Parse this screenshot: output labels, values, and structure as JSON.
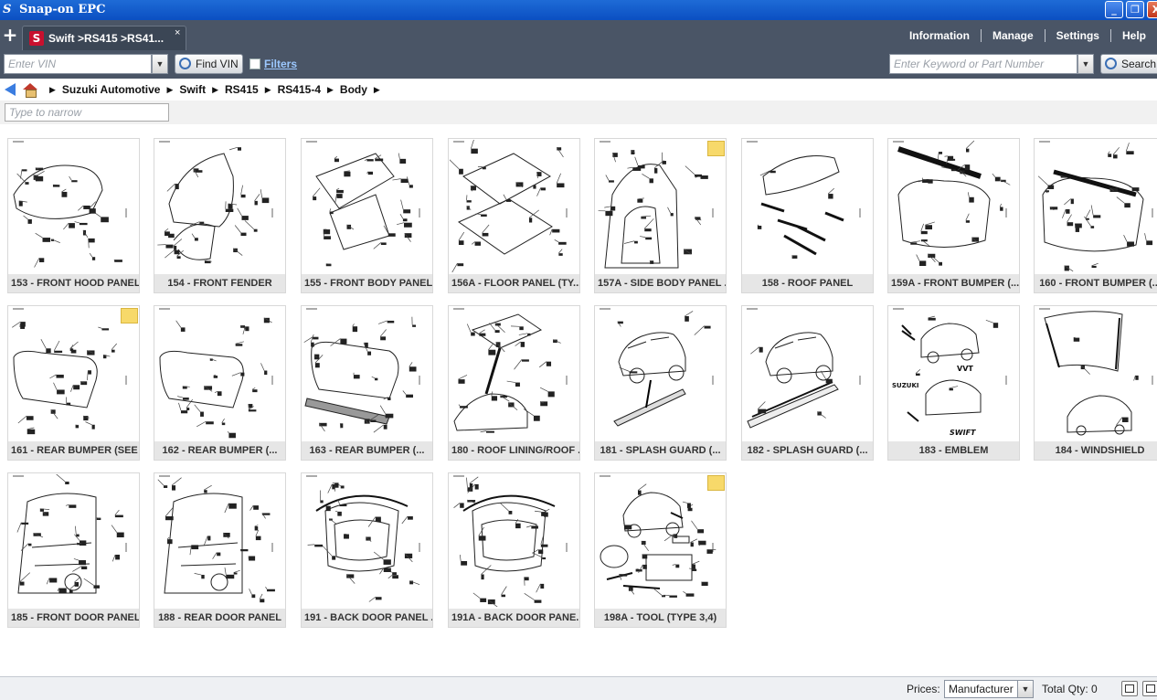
{
  "window": {
    "title": "Snap-on EPC",
    "app_icon": "snap-on-logo",
    "buttons": {
      "minimize": "_",
      "restore": "❐",
      "close": "X"
    }
  },
  "tabs": [
    {
      "label": "Swift >RS415 >RS41...",
      "icon": "suzuki-logo",
      "icon_text": "S",
      "close": "×"
    }
  ],
  "new_tab": "+",
  "top_menu": {
    "information": "Information",
    "manage": "Manage",
    "settings": "Settings",
    "help": "Help"
  },
  "vin": {
    "placeholder": "Enter VIN",
    "button": "Find VIN"
  },
  "filters": {
    "label": "Filters",
    "checked": false
  },
  "keyword": {
    "placeholder": "Enter Keyword or Part Number",
    "button": "Search"
  },
  "breadcrumb": [
    "Suzuki Automotive",
    "Swift",
    "RS415",
    "RS415-4",
    "Body"
  ],
  "narrow": {
    "placeholder": "Type to narrow"
  },
  "groups": [
    {
      "label": "153 - FRONT HOOD PANEL",
      "note": false,
      "art": "hood"
    },
    {
      "label": "154 - FRONT FENDER",
      "note": false,
      "art": "fender"
    },
    {
      "label": "155 - FRONT BODY PANEL",
      "note": false,
      "art": "frontbody"
    },
    {
      "label": "156A - FLOOR PANEL (TY...",
      "note": false,
      "art": "floor"
    },
    {
      "label": "157A - SIDE BODY PANEL ...",
      "note": true,
      "art": "sidebody"
    },
    {
      "label": "158 - ROOF PANEL",
      "note": false,
      "art": "roof"
    },
    {
      "label": "159A - FRONT BUMPER (...",
      "note": false,
      "art": "fbumper"
    },
    {
      "label": "160 - FRONT BUMPER (...",
      "note": false,
      "art": "fbumper2"
    },
    {
      "label": "161 - REAR BUMPER (SEE ...",
      "note": true,
      "art": "rbumper"
    },
    {
      "label": "162 - REAR BUMPER (...",
      "note": false,
      "art": "rbumper"
    },
    {
      "label": "163 - REAR BUMPER (...",
      "note": false,
      "art": "rbumper2"
    },
    {
      "label": "180 - ROOF LINING/ROOF ...",
      "note": false,
      "art": "lining"
    },
    {
      "label": "181 - SPLASH GUARD (...",
      "note": false,
      "art": "splash"
    },
    {
      "label": "182 - SPLASH GUARD (...",
      "note": false,
      "art": "splash2"
    },
    {
      "label": "183 - EMBLEM",
      "note": false,
      "art": "emblem",
      "art_text": [
        "SUZUKI",
        "VVT",
        "SWIFT"
      ]
    },
    {
      "label": "184 - WINDSHIELD",
      "note": false,
      "art": "windshield"
    },
    {
      "label": "185 - FRONT DOOR PANEL",
      "note": false,
      "art": "door"
    },
    {
      "label": "188 - REAR DOOR PANEL",
      "note": false,
      "art": "door"
    },
    {
      "label": "191 - BACK DOOR PANEL ...",
      "note": false,
      "art": "backdoor"
    },
    {
      "label": "191A - BACK DOOR PANE...",
      "note": false,
      "art": "backdoor"
    },
    {
      "label": "198A - TOOL (TYPE 3,4)",
      "note": true,
      "art": "tool"
    }
  ],
  "status": {
    "prices_label": "Prices:",
    "prices_value": "Manufacturer",
    "total_qty": "Total Qty: 0"
  }
}
